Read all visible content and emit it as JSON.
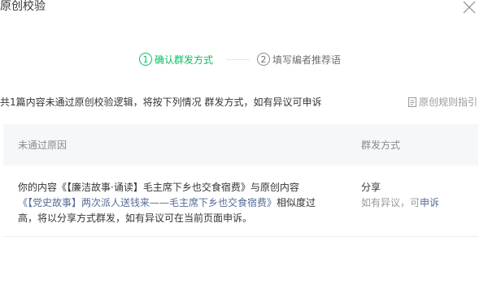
{
  "dialog": {
    "title": "原创校验",
    "close_icon": "close-icon"
  },
  "steps": [
    {
      "number": "1",
      "label": "确认群发方式",
      "active": true
    },
    {
      "number": "2",
      "label": "填写编者推荐语",
      "active": false
    }
  ],
  "intro": {
    "text": "共1篇内容未通过原创校验逻辑，将按下列情况 群发方式，如有异议可申诉"
  },
  "guide": {
    "icon": "document-icon",
    "label": "原创规则指引"
  },
  "table": {
    "headers": [
      "未通过原因",
      "群发方式"
    ],
    "rows": [
      {
        "reason_prefix": "你的内容《【廉洁故事·诵读】毛主席下乡也交食宿费》与原创内容",
        "reason_link": "《【党史故事】两次派人送钱来——毛主席下乡也交食宿费》",
        "reason_suffix": "相似度过高，将以分享方式群发，如有异议可在当前页面申诉。",
        "method": "分享",
        "method_note_prefix": "如有异议，可",
        "method_note_link": "申诉"
      }
    ]
  },
  "colors": {
    "accent": "#07c160",
    "link": "#576b95",
    "header_bg": "#f6f7f9"
  }
}
